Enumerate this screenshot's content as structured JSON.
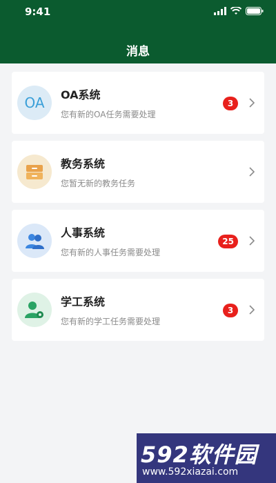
{
  "status_bar": {
    "time": "9:41"
  },
  "header": {
    "title": "消息"
  },
  "items": [
    {
      "id": "oa",
      "avatar_text": "OA",
      "title": "OA系统",
      "subtitle": "您有新的OA任务需要处理",
      "badge": "3"
    },
    {
      "id": "edu",
      "title": "教务系统",
      "subtitle": "您暂无新的教务任务",
      "badge": ""
    },
    {
      "id": "hr",
      "title": "人事系统",
      "subtitle": "您有新的人事任务需要处理",
      "badge": "25"
    },
    {
      "id": "stu",
      "title": "学工系统",
      "subtitle": "您有新的学工任务需要处理",
      "badge": "3"
    }
  ],
  "watermark": {
    "brand": "592软件园",
    "url": "www.592xiazai.com"
  },
  "colors": {
    "header": "#0b5b2f",
    "badge": "#e8201c",
    "background": "#f3f4f6"
  }
}
